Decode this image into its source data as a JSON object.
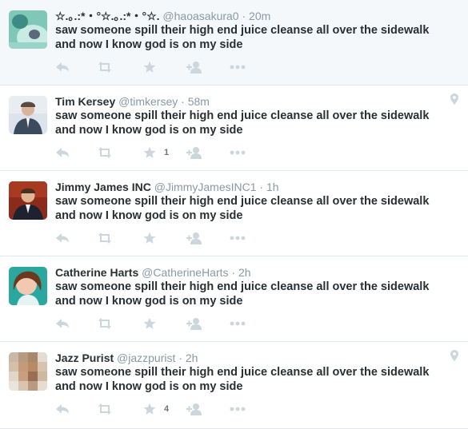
{
  "tweets": [
    {
      "name": "☆.｡.:*・°☆.｡.:*・°☆.",
      "handle": "@haoasakura0",
      "sep": "·",
      "time": "20m",
      "text": "saw someone spill their high end juice cleanse all over the sidewalk and now I know god is on my side",
      "favorites": "",
      "geo": false
    },
    {
      "name": "Tim Kersey",
      "handle": "@timkersey",
      "sep": "·",
      "time": "58m",
      "text": "saw someone spill their high end juice cleanse all over the sidewalk and now I know god is on my side",
      "favorites": "1",
      "geo": true
    },
    {
      "name": "Jimmy James INC",
      "handle": "@JimmyJamesINC1",
      "sep": "·",
      "time": "1h",
      "text": "saw someone spill their high end juice cleanse all over the sidewalk and now I know god is on my side",
      "favorites": "",
      "geo": false
    },
    {
      "name": "Catherine Harts",
      "handle": "@CatherineHarts",
      "sep": "·",
      "time": "2h",
      "text": "saw someone spill their high end juice cleanse all over the sidewalk and now I know god is on my side",
      "favorites": "",
      "geo": false
    },
    {
      "name": "Jazz Purist",
      "handle": "@jazzpurist",
      "sep": "·",
      "time": "2h",
      "text": "saw someone spill their high end juice cleanse all over the sidewalk and now I know god is on my side",
      "favorites": "4",
      "geo": true
    }
  ],
  "icons": {
    "reply": "reply-icon",
    "retweet": "retweet-icon",
    "favorite": "star-icon",
    "follow": "follow-icon",
    "more": "more-icon",
    "geo": "location-pin-icon"
  },
  "colors": {
    "icon": "#ccd6dd",
    "meta": "#8899a6",
    "text": "#292f33",
    "highlight_bg": "#f5f8fa",
    "divider": "#e1e8ed"
  }
}
